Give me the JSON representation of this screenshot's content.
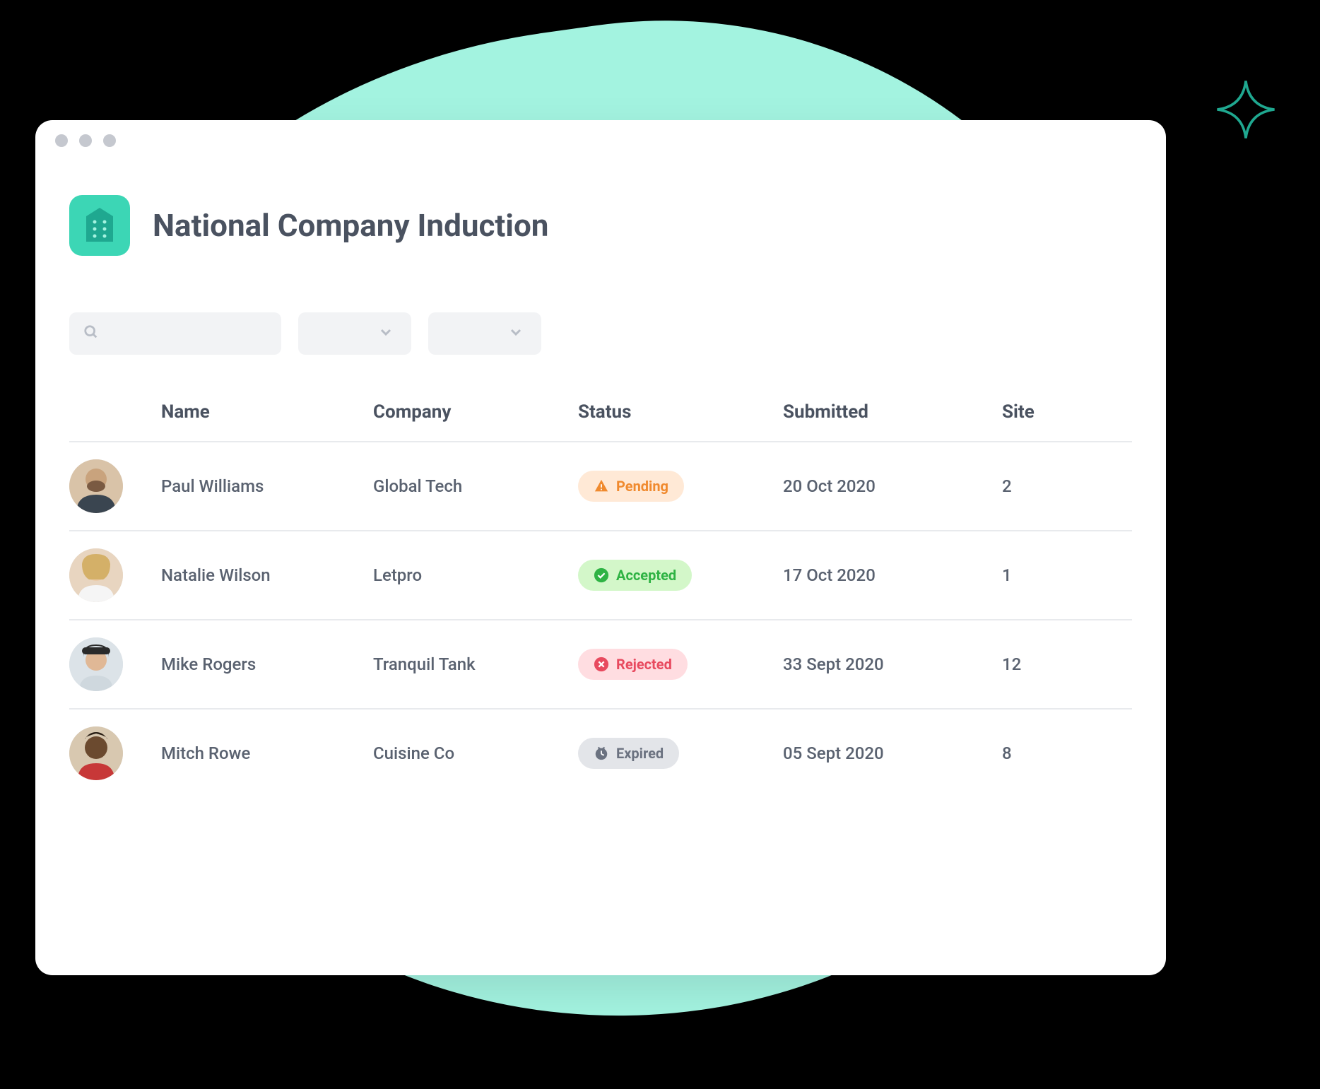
{
  "page": {
    "title": "National Company Induction"
  },
  "columns": {
    "name": "Name",
    "company": "Company",
    "status": "Status",
    "submitted": "Submitted",
    "site": "Site"
  },
  "rows": [
    {
      "name": "Paul Williams",
      "company": "Global Tech",
      "status": "Pending",
      "status_type": "pending",
      "submitted": "20 Oct 2020",
      "site": "2"
    },
    {
      "name": "Natalie Wilson",
      "company": "Letpro",
      "status": "Accepted",
      "status_type": "accepted",
      "submitted": "17 Oct 2020",
      "site": "1"
    },
    {
      "name": "Mike Rogers",
      "company": "Tranquil Tank",
      "status": "Rejected",
      "status_type": "rejected",
      "submitted": "33 Sept 2020",
      "site": "12"
    },
    {
      "name": "Mitch Rowe",
      "company": "Cuisine Co",
      "status": "Expired",
      "status_type": "expired",
      "submitted": "05 Sept 2020",
      "site": "8"
    }
  ],
  "colors": {
    "accent": "#3cd6b5",
    "pending_bg": "#ffe9d6",
    "pending_fg": "#f08a2e",
    "accepted_bg": "#d3f7c9",
    "accepted_fg": "#2fb344",
    "rejected_bg": "#ffdde1",
    "rejected_fg": "#e84a5f",
    "expired_bg": "#e3e5e9",
    "expired_fg": "#6b7280"
  },
  "icons": {
    "app": "building-icon",
    "search": "search-icon",
    "dropdown": "chevron-down-icon",
    "sparkle": "sparkle-icon",
    "pending": "warning-triangle-icon",
    "accepted": "check-circle-icon",
    "rejected": "x-circle-icon",
    "expired": "clock-icon"
  }
}
